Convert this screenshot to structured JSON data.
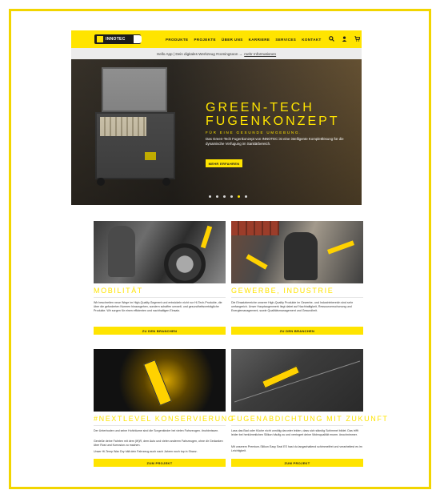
{
  "colors": {
    "accent": "#ffe400",
    "dark": "#1b1b1b",
    "notice_bg": "#ececec"
  },
  "nav": {
    "logo_text": "INNOTEC",
    "items": [
      "PRODUKTE",
      "PROJEKTE",
      "ÜBER UNS",
      "KARRIERE",
      "SERVICES",
      "KONTAKT"
    ],
    "icons": [
      "search-icon",
      "user-icon",
      "cart-icon"
    ]
  },
  "notice": {
    "text": "Hello App | Dein digitales Werkzeug #comingsoon →",
    "link": "mehr Informationen"
  },
  "hero": {
    "title_line1": "GREEN-TECH",
    "title_line2": "FUGENKONZEPT",
    "subtitle": "FÜR EINE GESUNDE UMGEBUNG.",
    "description": "Das Green-Tech Fugenkonzept von INNOTEC ist eine intelligente Komplettlösung für die dynamische Verfugung im Sanitärbereich.",
    "button": "MEHR ERFAHREN",
    "slides": 6,
    "active_slide": 5
  },
  "cards": [
    {
      "title": "MOBILITÄT",
      "paragraphs": [
        "Wir beschreiten neue Wege im High-Quality-Segment und entwickeln nicht nur Hi-Tech-Produkte, die über die geforderten Normen hinausgehen, sondern schaffen umwelt- und gesundheitsverträgliche Produkte. Wir sorgen für einen effizienten und nachhaltigen Einsatz."
      ],
      "button": "ZU DEN BRANCHEN"
    },
    {
      "title": "GEWERBE, INDUSTRIE",
      "paragraphs": [
        "Die Einsatzbereiche unserer High-Quality Produkte im Gewerbe- und Industriebereich sind sehr umfangreich. Unser Hauptaugenmerk liegt dabei auf Nachhaltigkeit, Ressourcenschonung und Energiemanagement, sowie Qualitätsmanagement und Gesundheit."
      ],
      "button": "ZU DEN BRANCHEN"
    },
    {
      "title": "#NEXTLEVEL KONSERVIERUNG",
      "paragraphs": [
        "Der Unterboden und seine Hohlräume sind die Sorgenkinder bei vielen Fahrzeugen. #nohinrissen.",
        "Genieße deine Fahrten mit dem (W)R, dem Auto und vielen anderen Fahrzeugen, ohne dir Gedanken über Rost und Korrosion zu machen.",
        "Unser Hi-Temp Wax Dry hält dein Fahrzeug auch nach Jahren noch top in Shanz."
      ],
      "button": "ZUM PROJEKT"
    },
    {
      "title": "FUGENABDICHTUNG MIT ZUKUNFT",
      "paragraphs": [
        "Lass das Bad oder Küche nicht unnötig darunter leiden, dass sich ständig Schimmel bildet. Das trifft leider bei herkömmlichen Silikon häufig zu und verringert deine Wohnqualität enorm. #nochnimmer.",
        "Mit unserem Premium-Silikon Easy Seal ES hast du langanhaltend schimmelfrei und verarbeitest es im Leichtigkeit."
      ],
      "button": "ZUM PROJEKT"
    }
  ]
}
